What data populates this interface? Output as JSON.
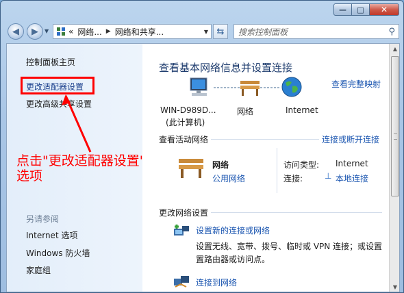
{
  "window": {
    "minimize_glyph": "—",
    "maximize_glyph": "□",
    "close_glyph": "✕"
  },
  "nav": {
    "back_glyph": "◀",
    "forward_glyph": "▶",
    "address": {
      "prefix": "«",
      "crumb1": "网络...",
      "crumb2": "网络和共享..."
    },
    "search_placeholder": "搜索控制面板"
  },
  "sidebar": {
    "home": "控制面板主页",
    "change_adapter": "更改适配器设置",
    "advanced_sharing": "更改高级共享设置",
    "see_also": "另请参阅",
    "internet_options": "Internet 选项",
    "firewall": "Windows 防火墙",
    "homegroup": "家庭组"
  },
  "annotation": {
    "line1": "点击\"更改适配器设置\"",
    "line2": "选项"
  },
  "main": {
    "title": "查看基本网络信息并设置连接",
    "view_full_map": "查看完整映射",
    "map": {
      "computer_name": "WIN-D989D...",
      "computer_sub": "(此计算机)",
      "network": "网络",
      "internet": "Internet"
    },
    "active_networks": {
      "heading": "查看活动网络",
      "connect_disconnect": "连接或断开连接",
      "network_name": "网络",
      "network_type": "公用网络",
      "access_type_label": "访问类型:",
      "access_type_value": "Internet",
      "connections_label": "连接:",
      "connections_value": "本地连接"
    },
    "change_settings": {
      "heading": "更改网络设置",
      "item1_link": "设置新的连接或网络",
      "item1_desc_line1": "设置无线、宽带、拨号、临时或 VPN 连接；或设置",
      "item1_desc_line2": "置路由器或访问点。",
      "item2_link": "连接到网络"
    }
  },
  "colors": {
    "link": "#1a55b0",
    "annotation_red": "#ff0000",
    "sidebar_bg": "#e3eefa"
  }
}
